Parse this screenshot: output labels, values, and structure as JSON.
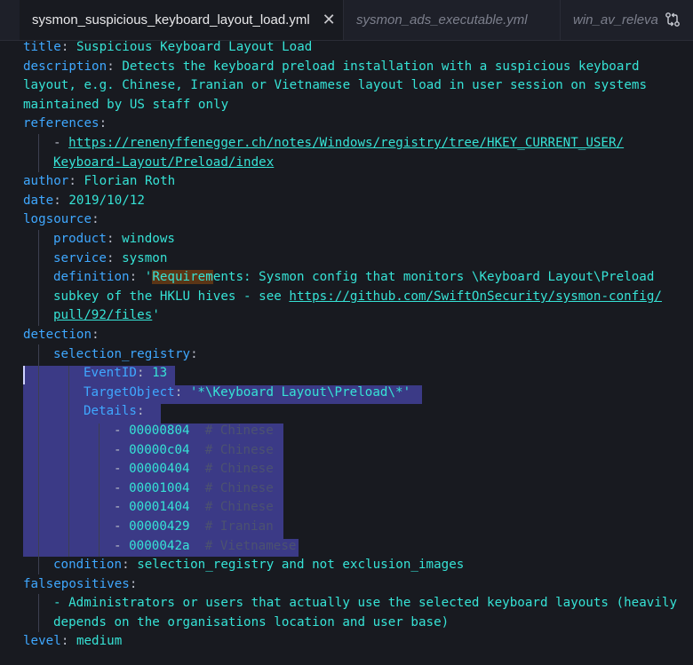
{
  "tabs": [
    {
      "label": "sysmon_suspicious_keyboard_layout_load.yml",
      "active": true
    },
    {
      "label": "sysmon_ads_executable.yml",
      "active": false
    },
    {
      "label": "win_av_releva",
      "active": false
    }
  ],
  "tab_close_glyph": "✕",
  "toolbar_icon": "compare-changes-icon",
  "colors": {
    "key": "#3fa8ff",
    "value": "#36e3d6",
    "comment": "#4c5270",
    "selection": "#3b3a86",
    "background": "#181a20"
  },
  "doc": {
    "title_key": "title",
    "title_val": "Suspicious Keyboard Layout Load",
    "description_key": "description",
    "description_l1": "Detects the keyboard preload installation with a suspicious keyboard",
    "description_l2": "layout, e.g. Chinese, Iranian or Vietnamese layout load in user session on systems",
    "description_l3": "maintained by US staff only",
    "references_key": "references",
    "reference_dash": "- ",
    "reference_l1": "https://renenyffenegger.ch/notes/Windows/registry/tree/HKEY_CURRENT_USER/",
    "reference_l2": "Keyboard-Layout/Preload/index",
    "author_key": "author",
    "author_val": "Florian Roth",
    "date_key": "date",
    "date_val": "2019/10/12",
    "logsource_key": "logsource",
    "product_key": "product",
    "product_val": "windows",
    "service_key": "service",
    "service_val": "sysmon",
    "definition_key": "definition",
    "definition_quote": "'",
    "definition_match": "Requirem",
    "definition_rest": "ents: Sysmon config that monitors \\Keyboard Layout\\Preload",
    "definition_l2": "subkey of the HKLU hives - see ",
    "definition_link1": "https://github.com/SwiftOnSecurity/sysmon-config/",
    "definition_link2": "pull/92/files",
    "definition_end": "'",
    "detection_key": "detection",
    "selection_key": "selection_registry",
    "eventid_key": "EventID",
    "eventid_val": "13",
    "target_key": "TargetObject",
    "target_val": "'*\\Keyboard Layout\\Preload\\*'",
    "details_key": "Details",
    "details": [
      {
        "value": "00000804",
        "comment": "# Chinese"
      },
      {
        "value": "00000c04",
        "comment": "# Chinese"
      },
      {
        "value": "00000404",
        "comment": "# Chinese"
      },
      {
        "value": "00001004",
        "comment": "# Chinese"
      },
      {
        "value": "00001404",
        "comment": "# Chinese"
      },
      {
        "value": "00000429",
        "comment": "# Iranian"
      },
      {
        "value": "0000042a",
        "comment": "# Vietnamese"
      }
    ],
    "condition_key": "condition",
    "condition_val": "selection_registry and not exclusion_images",
    "falsepositives_key": "falsepositives",
    "fp_l1": "- Administrators or users that actually use the selected keyboard layouts (heavily",
    "fp_l2": "depends on the organisations location and user base)",
    "level_key": "level",
    "level_val": "medium"
  }
}
